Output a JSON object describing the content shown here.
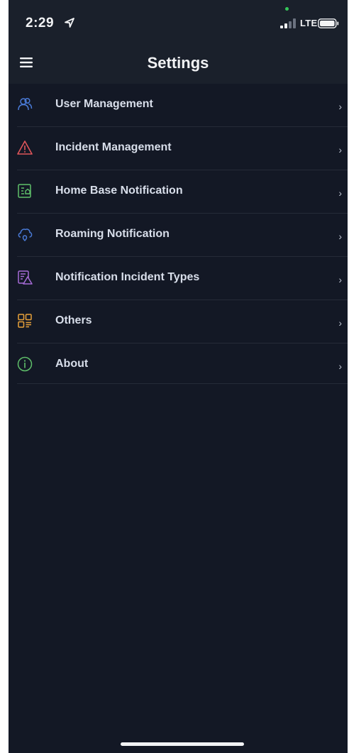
{
  "status_bar": {
    "time": "2:29",
    "network": "LTE",
    "location_icon": "location-arrow-icon",
    "signal_icon": "signal-bars-icon",
    "battery_icon": "battery-icon"
  },
  "app_bar": {
    "title": "Settings",
    "menu_icon": "hamburger-menu-icon"
  },
  "settings": {
    "items": [
      {
        "label": "User Management",
        "icon": "users-icon",
        "color": "#4a7bd8"
      },
      {
        "label": "Incident Management",
        "icon": "warning-triangle-icon",
        "color": "#e0555a"
      },
      {
        "label": "Home Base Notification",
        "icon": "home-base-icon",
        "color": "#5fbf6a"
      },
      {
        "label": "Roaming Notification",
        "icon": "cloud-roaming-icon",
        "color": "#4a7bd8"
      },
      {
        "label": "Notification Incident Types",
        "icon": "incident-types-icon",
        "color": "#a66bd6"
      },
      {
        "label": "Others",
        "icon": "grid-icon",
        "color": "#e8a13a"
      },
      {
        "label": "About",
        "icon": "info-icon",
        "color": "#5fbf6a"
      }
    ],
    "chevron": "›"
  },
  "colors": {
    "background": "#131825",
    "header": "#1a202b",
    "text": "#d8deea"
  }
}
